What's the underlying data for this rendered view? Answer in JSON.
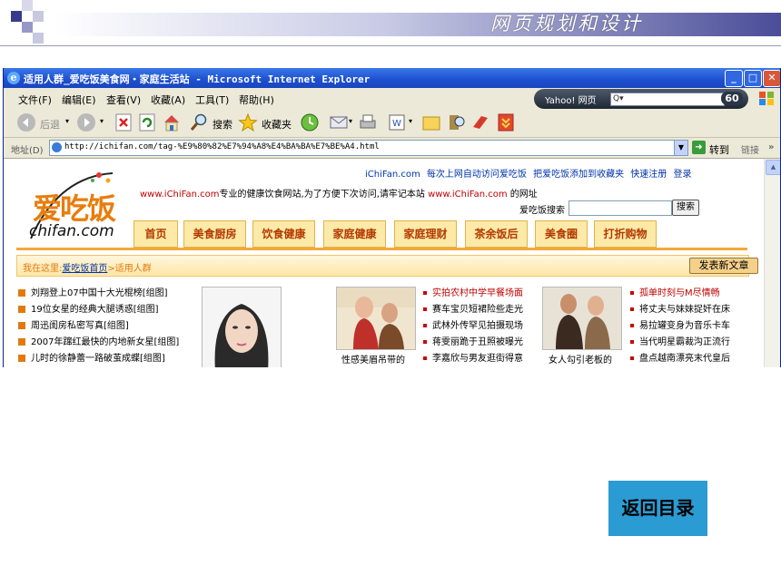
{
  "slide": {
    "title": "网页规划和设计",
    "return_label": "返回目录",
    "colors": {
      "band_dark": "#4a4d98",
      "return_bg": "#2b9cd3"
    }
  },
  "window": {
    "title": "适用人群_爱吃饭美食网・家庭生活站 - Microsoft Internet Explorer",
    "icon": "ie-icon",
    "controls": {
      "minimize": "_",
      "maximize": "□",
      "close": "✕"
    }
  },
  "menubar": {
    "items": [
      "文件(F)",
      "编辑(E)",
      "查看(V)",
      "收藏(A)",
      "工具(T)",
      "帮助(H)"
    ],
    "yahoo": {
      "brand": "Yahoo! 网页",
      "go": "60"
    }
  },
  "toolbar": {
    "back": "后退",
    "search": "搜索",
    "favorites": "收藏夹"
  },
  "address": {
    "label": "地址(D)",
    "url": "http://ichifan.com/tag-%E9%80%82%E7%94%A8%E4%BA%BA%E7%BE%A4.html",
    "go": "转到",
    "links": "链接"
  },
  "page": {
    "logo_text": "爱吃饭",
    "logo_domain": "chifan.com",
    "top_links": [
      "iChiFan.com",
      "每次上网自动访问爱吃饭",
      "把爱吃饭添加到收藏夹",
      "快速注册",
      "登录"
    ],
    "welcome_site": "www.iChiFan.com",
    "welcome_text": "专业的健康饮食网站,为了方便下次访问,请牢记本站",
    "welcome_site2": "www.iChiFan.com",
    "welcome_tail": "的网址",
    "search_label": "爱吃饭搜索",
    "search_button": "搜索",
    "nav": [
      "首页",
      "美食厨房",
      "饮食健康",
      "家庭健康",
      "家庭理财",
      "茶余饭后",
      "美食圈",
      "打折购物"
    ],
    "breadcrumb_prefix": "我在这里:",
    "breadcrumb_home": "爱吃饭首页",
    "breadcrumb_current": ">适用人群",
    "post_button": "发表新文章",
    "list1": [
      "刘翔登上07中国十大光棍榜[组图]",
      "19位女星的经典大腿诱惑[组图]",
      "周迅闺房私密写真[组图]",
      "2007年蹿红最快的内地新女星[组图]",
      "儿时的徐静蕾一路破茧成蝶[组图]"
    ],
    "caption1": "性感美眉吊带的",
    "list2_head": "实拍农村中学早餐场面",
    "list2": [
      "赛车宝贝短裙险些走光",
      "武林外传罕见拍摄现场",
      "蒋雯丽跪于丑照被曝光",
      "李嘉欣与男友逛街得意"
    ],
    "caption2": "女人勾引老板的",
    "list3_head": "孤单时刻与M尽情畅",
    "list3": [
      "将丈夫与妹妹捉奸在床",
      "易拉罐变身为音乐卡车",
      "当代明星霸裁沟正流行",
      "盘点越南漂亮末代皇后"
    ]
  }
}
